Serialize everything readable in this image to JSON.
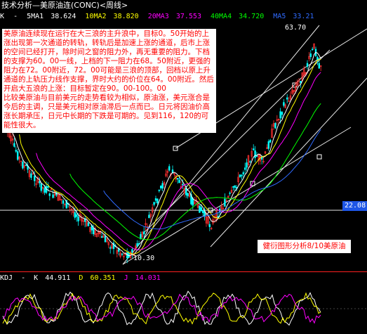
{
  "window": {
    "title": "技术分析—美原油连(CONC)<周线>"
  },
  "ma_bar": {
    "label": "K",
    "items": [
      {
        "name": "5MA1",
        "value": "38.624",
        "color": "#ffffff"
      },
      {
        "name": "10MA2",
        "value": "38.820",
        "color": "#ffff00"
      },
      {
        "name": "20MA3",
        "value": "37.553",
        "color": "#ff00ff"
      },
      {
        "name": "40MA4",
        "value": "34.720",
        "color": "#00ff00"
      },
      {
        "name": "MA5",
        "value": "33.21",
        "color": "#2f6bff"
      }
    ]
  },
  "annotation": {
    "paragraph1": "美原油连续现在运行在大三浪的主升浪中，目标0。50开始的上涨出现第一次通道的转轨，转轨后是加速上涨的通道，后市上涨的空间已经打开，除时间之窗的阻力外，再无重要的阻力。下档的支撑为60。00一线，上档的下一阻力在68。50附近，更强的阻力在72。00附近，72。00可能是三浪的顶部，回档以原上升通道的上轨压力线作支撑，界时大约的价位在64。00附近。然后开启大五浪的上涨：目标暂定在90。00-100。00",
    "paragraph2": "比较美原油与目前美元的走势看较为相似，原油涨，美元涨合是今后的主调，只是美元相对原油滞后一点而已。日元将因油价高涨长期承压，日元中长期的下跌是可期的。见到116，120的可能性很大。",
    "color": "#ff0000"
  },
  "price_labels": {
    "high": "63.70",
    "low": "10.30",
    "current": "22.08"
  },
  "watermark": "健衍图形分析8/10美原油",
  "kdj_bar": {
    "label": "KDJ",
    "items": [
      {
        "name": "K",
        "value": "44.911",
        "color": "#ffffff"
      },
      {
        "name": "D",
        "value": "60.351",
        "color": "#ffff00"
      },
      {
        "name": "J",
        "value": "14.031",
        "color": "#ff00ff"
      }
    ]
  },
  "colors": {
    "background": "#000000",
    "up_candle": "#ff3030",
    "down_candle": "#00ffff",
    "grid": "#ffffff"
  }
}
